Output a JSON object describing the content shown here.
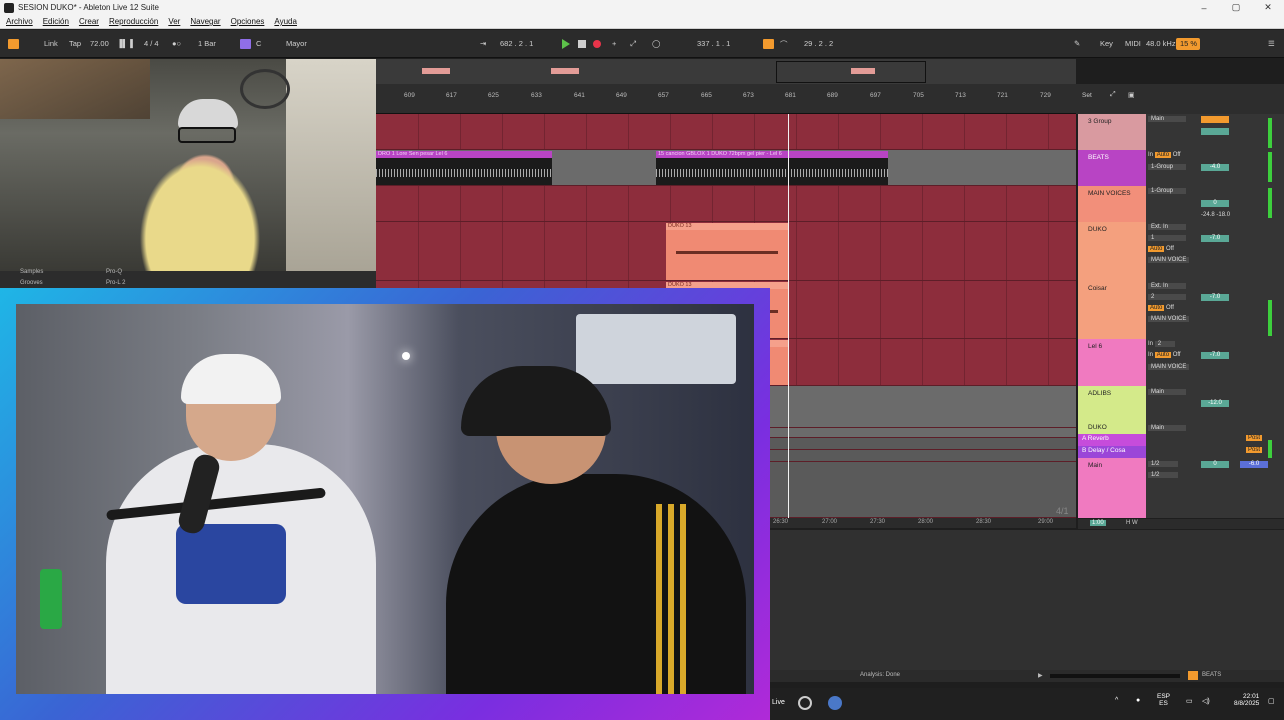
{
  "window": {
    "title": "SESION DUKO* - Ableton Live 12 Suite",
    "controls": [
      "–",
      "▢",
      "✕"
    ]
  },
  "menu": [
    "Archivo",
    "Edición",
    "Crear",
    "Reproducción",
    "Ver",
    "Navegar",
    "Opciones",
    "Ayuda"
  ],
  "controlbar": {
    "link": "Link",
    "tap": "Tap",
    "tempo": "72.00",
    "signature": "4 / 4",
    "quantize": "1 Bar",
    "key": "C",
    "scale": "Mayor",
    "position": "682 .  2 .  1",
    "loop_start": "337 .  1 .  1",
    "loop_length": "29 .  2 .  2",
    "key_label": "Key",
    "midi_label": "MIDI",
    "sample_rate": "48.0 kHz",
    "cpu": "15 %"
  },
  "ruler": {
    "ticks": [
      "609",
      "617",
      "625",
      "633",
      "641",
      "649",
      "657",
      "665",
      "673",
      "681",
      "689",
      "697",
      "705",
      "713",
      "721",
      "729"
    ],
    "set_label": "Set"
  },
  "clips": {
    "beats_clip_1": "DRO 1 Lore Sen pesar Lel 6",
    "beats_clip_2": "15 cancion GBLOX 1 DUKO 72bpm gel pier - Lel 6",
    "duko_clip": "DUKO 13",
    "duko_clip_2": "DUKO 13"
  },
  "tracks": [
    {
      "name": "3 Group",
      "color": "#d99aa0",
      "out": "Main"
    },
    {
      "name": "BEATS",
      "color": "#b844c4",
      "in": "In",
      "mode": "Auto",
      "off": "Off",
      "out": "1-Group",
      "vol": "-4.0"
    },
    {
      "name": "MAIN VOICES",
      "color": "#f28f7a",
      "out": "1-Group",
      "vol": "0",
      "extra": "-24.8",
      "extra2": "-18.0"
    },
    {
      "name": "DUKO",
      "color": "#f4a07e",
      "in": "Ext. In",
      "ch": "1",
      "mode": "Auto",
      "off": "Off",
      "out": "MAIN VOICE",
      "vol": "-7.0"
    },
    {
      "name": "Coisar",
      "color": "#f4a07e",
      "in": "Ext. In",
      "ch": "2",
      "mode": "Auto",
      "off": "Off",
      "out": "MAIN VOICE",
      "vol": "-7.0"
    },
    {
      "name": "Lel 6",
      "color": "#f07ac0",
      "in": "In",
      "ch": "2",
      "mode": "Auto",
      "off": "Off",
      "out": "MAIN VOICE",
      "vol": "-7.0"
    },
    {
      "name": "ADLIBS",
      "color": "#d4ea8a",
      "out": "Main",
      "vol": "-12.0"
    },
    {
      "name": "DUKO",
      "color": "#d4ea8a",
      "out": "Main"
    },
    {
      "name": "A Reverb",
      "color": "#c64cdb",
      "post": "Post"
    },
    {
      "name": "B Delay / Cosa",
      "color": "#9b46d8",
      "post": "Post"
    },
    {
      "name": "Main",
      "color": "#f07ac0",
      "in_main": "1/2",
      "out_main": "1/2",
      "vol": "0",
      "vol2": "-6.0"
    }
  ],
  "mixer_misc": {
    "scroll_label": "4/1",
    "zoom": "1:00",
    "hw": "H  W"
  },
  "bottom_ruler": [
    "26:30",
    "27:00",
    "27:30",
    "28:00",
    "28:30",
    "29:00"
  ],
  "status": {
    "analysis": "Analysis: Done",
    "beats_tag": "BEATS"
  },
  "browser_sliver": {
    "samples": "Samples",
    "grooves": "Grooves",
    "item1": "Pro-Q",
    "item2": "Pro-L 2"
  },
  "taskbar": {
    "lang": "ESP",
    "lang2": "ES",
    "time": "22:01",
    "date": "8/8/2025",
    "live_label": "Live"
  },
  "colors": {
    "track_bg": "#8d2d3c",
    "accent_orange": "#f29a2e",
    "play_green": "#5dc24a",
    "record_red": "#e8344a"
  }
}
